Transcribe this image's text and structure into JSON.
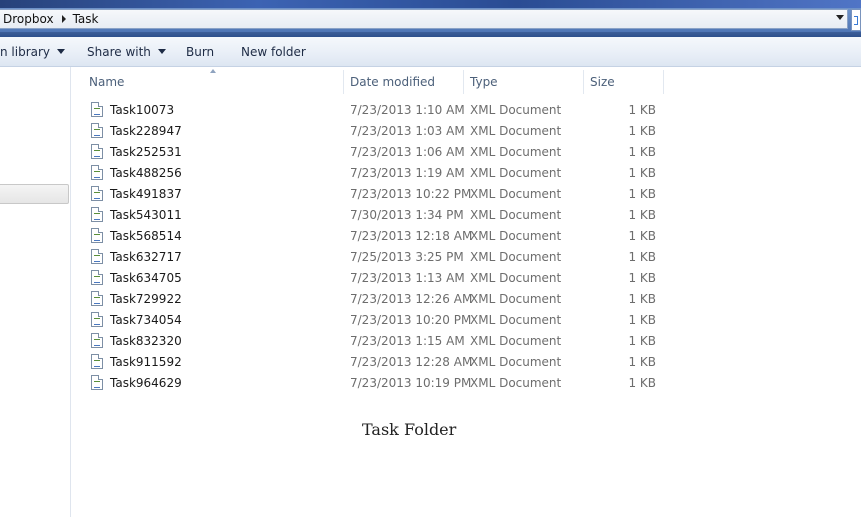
{
  "address": {
    "crumbs": [
      "Dropbox",
      "Task"
    ]
  },
  "toolbar": {
    "library_label": "n library",
    "share_label": "Share with",
    "burn_label": "Burn",
    "new_folder_label": "New folder"
  },
  "columns": {
    "name": "Name",
    "date": "Date modified",
    "type": "Type",
    "size": "Size"
  },
  "files": [
    {
      "name": "Task10073",
      "date": "7/23/2013 1:10 AM",
      "type": "XML Document",
      "size": "1 KB"
    },
    {
      "name": "Task228947",
      "date": "7/23/2013 1:03 AM",
      "type": "XML Document",
      "size": "1 KB"
    },
    {
      "name": "Task252531",
      "date": "7/23/2013 1:06 AM",
      "type": "XML Document",
      "size": "1 KB"
    },
    {
      "name": "Task488256",
      "date": "7/23/2013 1:19 AM",
      "type": "XML Document",
      "size": "1 KB"
    },
    {
      "name": "Task491837",
      "date": "7/23/2013 10:22 PM",
      "type": "XML Document",
      "size": "1 KB"
    },
    {
      "name": "Task543011",
      "date": "7/30/2013 1:34 PM",
      "type": "XML Document",
      "size": "1 KB"
    },
    {
      "name": "Task568514",
      "date": "7/23/2013 12:18 AM",
      "type": "XML Document",
      "size": "1 KB"
    },
    {
      "name": "Task632717",
      "date": "7/25/2013 3:25 PM",
      "type": "XML Document",
      "size": "1 KB"
    },
    {
      "name": "Task634705",
      "date": "7/23/2013 1:13 AM",
      "type": "XML Document",
      "size": "1 KB"
    },
    {
      "name": "Task729922",
      "date": "7/23/2013 12:26 AM",
      "type": "XML Document",
      "size": "1 KB"
    },
    {
      "name": "Task734054",
      "date": "7/23/2013 10:20 PM",
      "type": "XML Document",
      "size": "1 KB"
    },
    {
      "name": "Task832320",
      "date": "7/23/2013 1:15 AM",
      "type": "XML Document",
      "size": "1 KB"
    },
    {
      "name": "Task911592",
      "date": "7/23/2013 12:28 AM",
      "type": "XML Document",
      "size": "1 KB"
    },
    {
      "name": "Task964629",
      "date": "7/23/2013 10:19 PM",
      "type": "XML Document",
      "size": "1 KB"
    }
  ],
  "caption": "Task Folder"
}
